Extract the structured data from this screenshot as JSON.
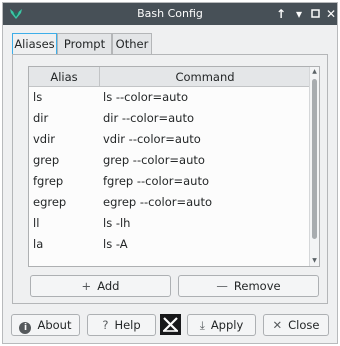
{
  "window": {
    "title": "Bash Config"
  },
  "titlebar": {
    "app_icon": "kde-app-icon",
    "keep_above_icon": "↑",
    "minimize_icon": "▾",
    "maximize_icon": "▫",
    "close_icon": "✕"
  },
  "tabs": [
    {
      "label": "Aliases",
      "active": true
    },
    {
      "label": "Prompt",
      "active": false
    },
    {
      "label": "Other",
      "active": false
    }
  ],
  "table": {
    "columns": [
      "Alias",
      "Command"
    ],
    "rows": [
      {
        "alias": "ls",
        "command": "ls --color=auto"
      },
      {
        "alias": "dir",
        "command": "dir --color=auto"
      },
      {
        "alias": "vdir",
        "command": "vdir --color=auto"
      },
      {
        "alias": "grep",
        "command": "grep --color=auto"
      },
      {
        "alias": "fgrep",
        "command": "fgrep --color=auto"
      },
      {
        "alias": "egrep",
        "command": "egrep --color=auto"
      },
      {
        "alias": "ll",
        "command": "ls -lh"
      },
      {
        "alias": "la",
        "command": "ls -A"
      }
    ]
  },
  "actions": {
    "add_icon": "+",
    "add_label": "Add",
    "remove_icon": "—",
    "remove_label": "Remove"
  },
  "footer": {
    "about_label": "About",
    "about_icon": "i",
    "help_label": "Help",
    "help_icon": "?",
    "apply_label": "Apply",
    "apply_icon": "⤓",
    "close_label": "Close",
    "close_icon": "✕"
  }
}
